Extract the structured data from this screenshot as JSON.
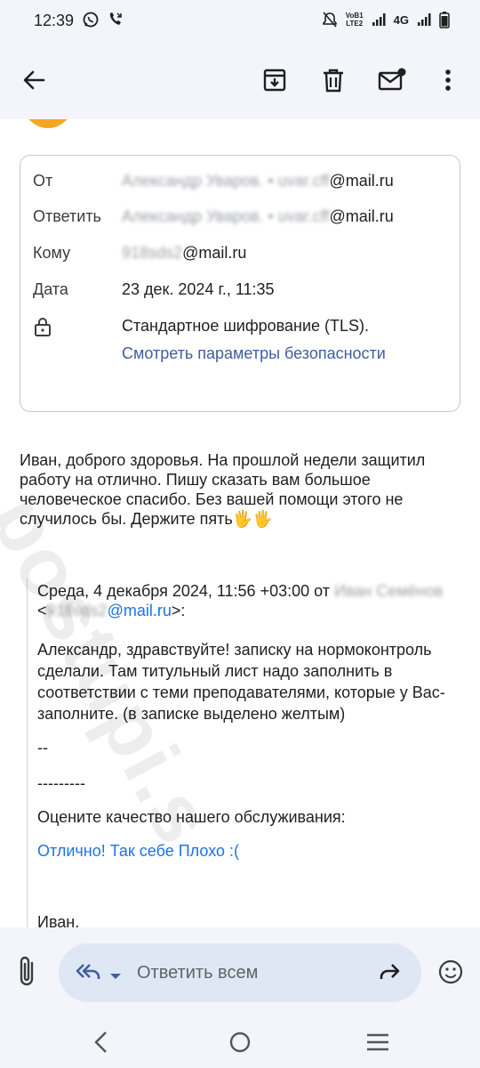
{
  "status_bar": {
    "time": "12:39",
    "lte_top": "VoB1",
    "lte_bottom": "LTE2",
    "network": "4G"
  },
  "app_bar": {
    "icons": [
      "back-arrow-icon",
      "archive-icon",
      "delete-icon",
      "mark-unread-icon",
      "more-vert-icon"
    ]
  },
  "details": {
    "from_label": "От",
    "from_name_blurred": "Александр Уваров. • uvar.cff",
    "from_domain": "@mail.ru",
    "reply_to_label": "Ответить",
    "reply_to_name_blurred": "Александр Уваров. • uvar.cff",
    "reply_to_domain": "@mail.ru",
    "to_label": "Кому",
    "to_blurred": "918sds2",
    "to_domain": "@mail.ru",
    "date_label": "Дата",
    "date_value": "23 дек. 2024 г., 11:35",
    "encryption": "Стандартное шифрование (TLS).",
    "security_link": "Смотреть параметры безопасности"
  },
  "body": {
    "text": "Иван, доброго здоровья. На прошлой недели защитил работу на отлично. Пишу сказать вам большое человеческое спасибо. Без вашей помощи этого не случилось бы. Держите пять🖐🖐"
  },
  "quote": {
    "header_prefix": "Среда, 4 декабря 2024, 11:56 +03:00 от",
    "header_sender_blurred": "Иван Семёнов",
    "lt": "<",
    "email_blurred": "918sds2",
    "email_domain": "@mail.ru",
    "gt": ">:",
    "paragraph": "Александр, здравствуйте! записку на нормоконтроль сделали. Там титульный лист надо заполнить в соответствии с теми преподавателями,  которые у Вас-заполните. (в записке выделено желтым)",
    "sig_dash": "--",
    "sep_line": "---------",
    "rate_prompt": "Оцените качество нашего обслуживания:",
    "rate_links": "Отлично! Так себе Плохо :(",
    "sign_name": "Иван,"
  },
  "reply_bar": {
    "placeholder": "Ответить всем"
  },
  "watermark": "postupi.s"
}
